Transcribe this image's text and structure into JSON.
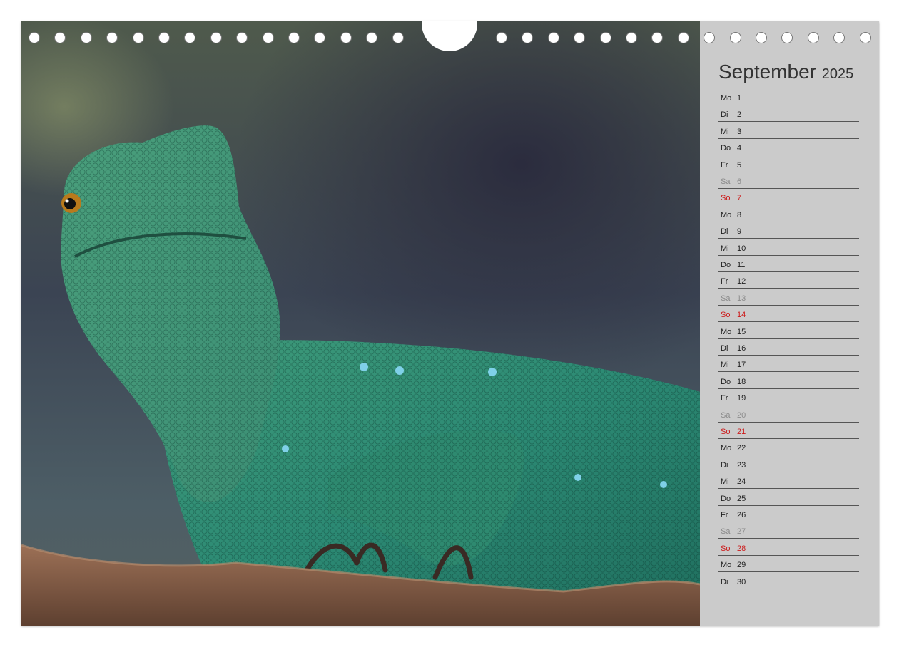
{
  "calendar": {
    "month": "September",
    "year": "2025",
    "days": [
      {
        "name": "Mo",
        "num": "1",
        "type": "weekday"
      },
      {
        "name": "Di",
        "num": "2",
        "type": "weekday"
      },
      {
        "name": "Mi",
        "num": "3",
        "type": "weekday"
      },
      {
        "name": "Do",
        "num": "4",
        "type": "weekday"
      },
      {
        "name": "Fr",
        "num": "5",
        "type": "weekday"
      },
      {
        "name": "Sa",
        "num": "6",
        "type": "sat"
      },
      {
        "name": "So",
        "num": "7",
        "type": "sun"
      },
      {
        "name": "Mo",
        "num": "8",
        "type": "weekday"
      },
      {
        "name": "Di",
        "num": "9",
        "type": "weekday"
      },
      {
        "name": "Mi",
        "num": "10",
        "type": "weekday"
      },
      {
        "name": "Do",
        "num": "11",
        "type": "weekday"
      },
      {
        "name": "Fr",
        "num": "12",
        "type": "weekday"
      },
      {
        "name": "Sa",
        "num": "13",
        "type": "sat"
      },
      {
        "name": "So",
        "num": "14",
        "type": "sun"
      },
      {
        "name": "Mo",
        "num": "15",
        "type": "weekday"
      },
      {
        "name": "Di",
        "num": "16",
        "type": "weekday"
      },
      {
        "name": "Mi",
        "num": "17",
        "type": "weekday"
      },
      {
        "name": "Do",
        "num": "18",
        "type": "weekday"
      },
      {
        "name": "Fr",
        "num": "19",
        "type": "weekday"
      },
      {
        "name": "Sa",
        "num": "20",
        "type": "sat"
      },
      {
        "name": "So",
        "num": "21",
        "type": "sun"
      },
      {
        "name": "Mo",
        "num": "22",
        "type": "weekday"
      },
      {
        "name": "Di",
        "num": "23",
        "type": "weekday"
      },
      {
        "name": "Mi",
        "num": "24",
        "type": "weekday"
      },
      {
        "name": "Do",
        "num": "25",
        "type": "weekday"
      },
      {
        "name": "Fr",
        "num": "26",
        "type": "weekday"
      },
      {
        "name": "Sa",
        "num": "27",
        "type": "sat"
      },
      {
        "name": "So",
        "num": "28",
        "type": "sun"
      },
      {
        "name": "Mo",
        "num": "29",
        "type": "weekday"
      },
      {
        "name": "Di",
        "num": "30",
        "type": "weekday"
      }
    ]
  },
  "colors": {
    "sunday": "#cc1b1b",
    "saturday": "#8c8c8c",
    "weekday": "#222222",
    "sidebar_bg": "#cbcbcb",
    "lizard_green": "#2f8a6e"
  }
}
